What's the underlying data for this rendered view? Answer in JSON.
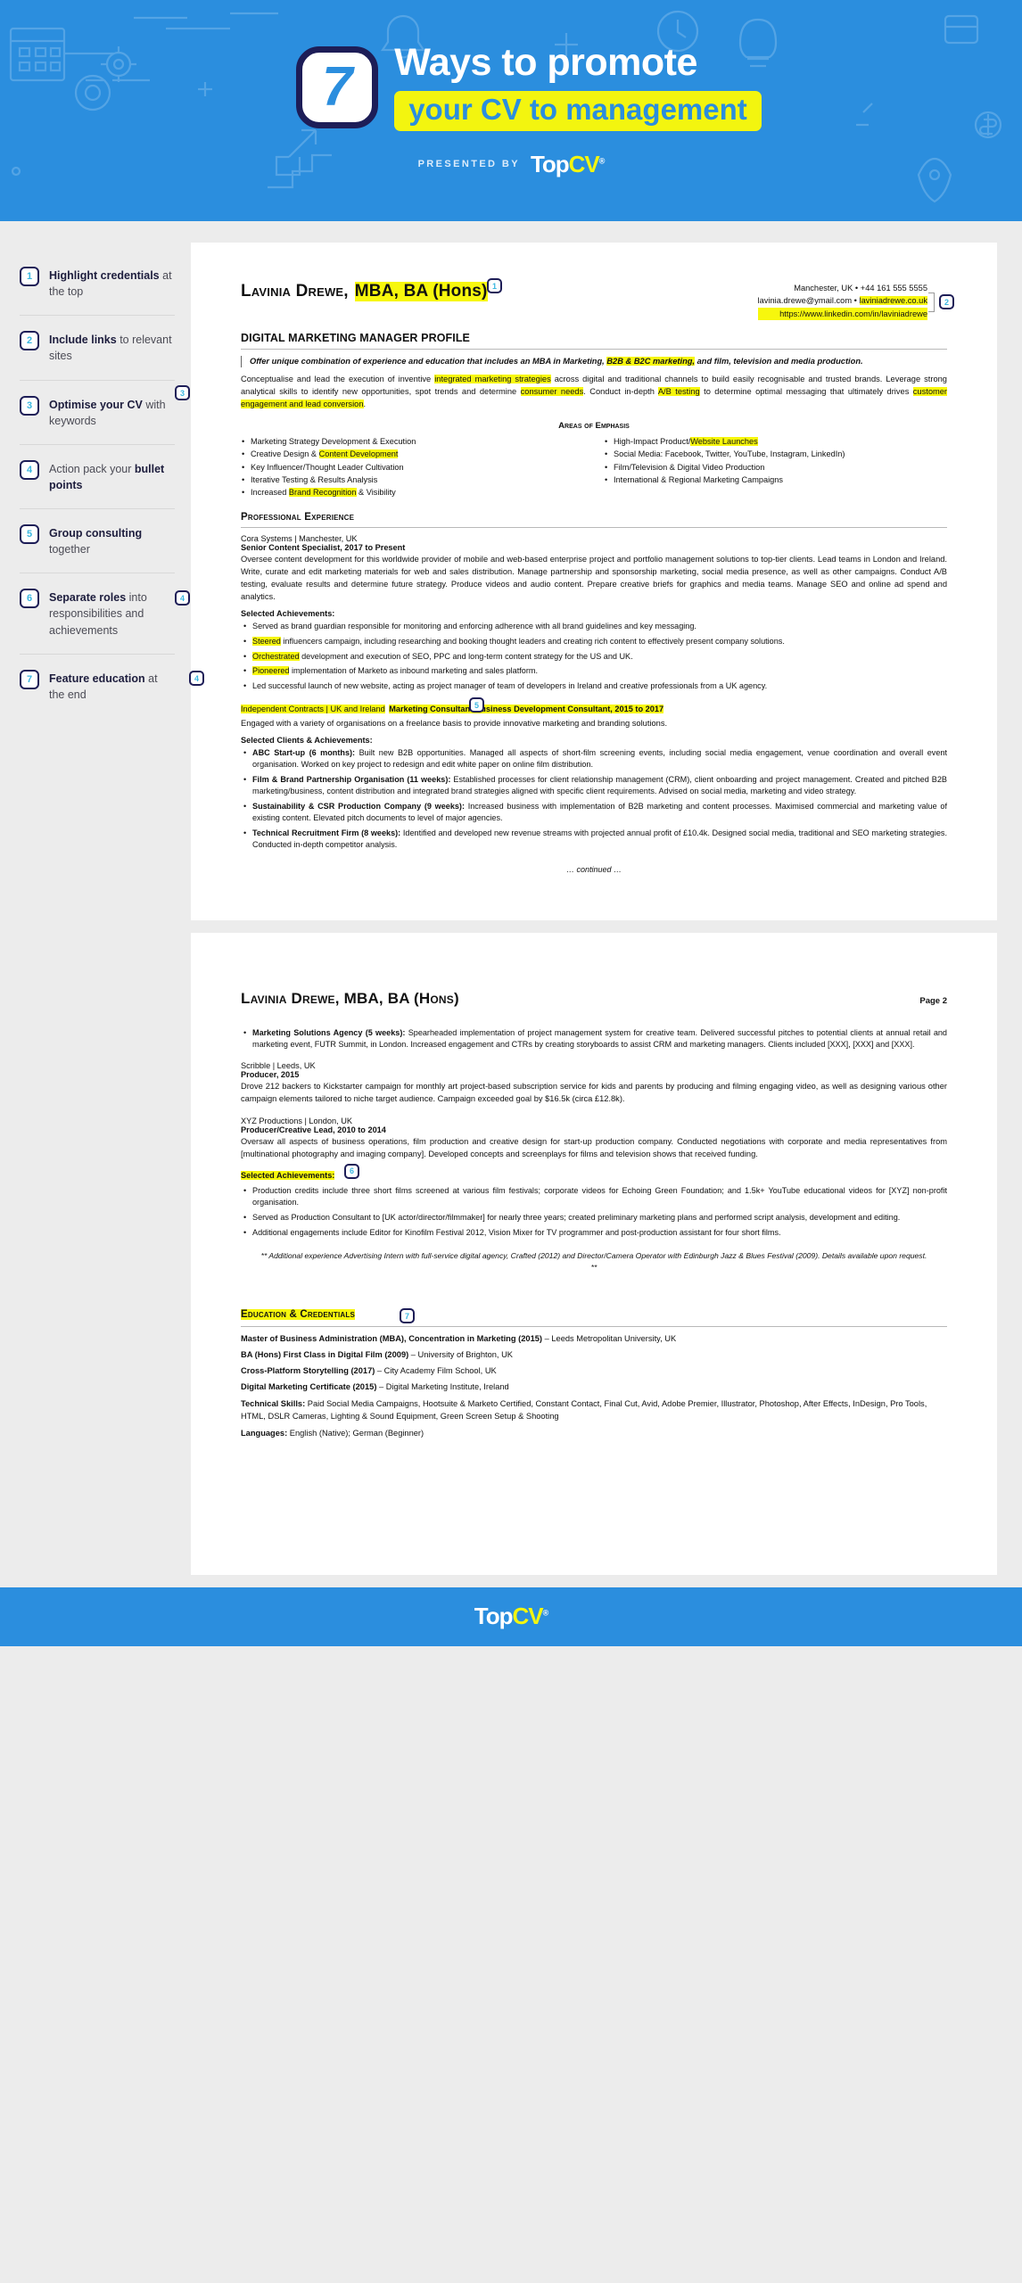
{
  "hero": {
    "number": "7",
    "title": "Ways to promote",
    "title_highlight": "your CV to management",
    "presented_by": "PRESENTED BY",
    "brand_top": "Top",
    "brand_cv": "CV",
    "brand_tm": "®"
  },
  "sidebar": {
    "items": [
      {
        "num": "1",
        "bold": "Highlight credentials",
        "rest": " at the top"
      },
      {
        "num": "2",
        "bold": "Include links",
        "rest": " to relevant sites"
      },
      {
        "num": "3",
        "bold": "Optimise your CV",
        "rest": " with keywords"
      },
      {
        "num": "4",
        "pre": "Action pack your ",
        "bold": "bullet points",
        "rest": ""
      },
      {
        "num": "5",
        "bold": "Group consulting",
        "rest": " together"
      },
      {
        "num": "6",
        "bold": "Separate roles",
        "rest": " into responsibilities and achievements"
      },
      {
        "num": "7",
        "bold": "Feature education",
        "rest": " at the end"
      }
    ]
  },
  "cv": {
    "name_main": "Lavinia Drewe, ",
    "name_highlight": "MBA, BA (Hons)",
    "contact_line1": "Manchester, UK • +44 161 555 5555",
    "contact_email": "lavinia.drewe@ymail.com • ",
    "contact_site": "laviniadrewe.co.uk",
    "contact_linkedin": "https://www.linkedin.com/in/laviniadrewe",
    "job_title": "DIGITAL MARKETING MANAGER PROFILE",
    "summary_a": "Offer unique combination of experience and education that includes an MBA in Marketing, ",
    "summary_b": "B2B & B2C marketing,",
    "summary_c": " and film, television and media production.",
    "para1_a": "Conceptualise and lead the execution of inventive ",
    "para1_hl1": "integrated marketing strategies",
    "para1_b": " across digital and traditional channels to build easily recognisable and trusted brands. Leverage strong analytical skills to identify new opportunities, spot trends and determine ",
    "para1_hl2": "consumer needs",
    "para1_c": ". Conduct in-depth ",
    "para1_hl3": "A/B testing",
    "para1_d": " to determine optimal messaging that ultimately drives ",
    "para1_hl4": "customer engagement and lead conversion",
    "para1_e": ".",
    "emphasis_heading": "Areas of Emphasis",
    "emphasis_left": [
      {
        "text": "Marketing Strategy Development & Execution"
      },
      {
        "pre": "Creative Design & ",
        "hl": "Content Development"
      },
      {
        "text": "Key Influencer/Thought Leader Cultivation"
      },
      {
        "text": "Iterative Testing & Results Analysis"
      },
      {
        "pre": "Increased ",
        "hl": "Brand Recognition",
        "post": " & Visibility"
      }
    ],
    "emphasis_right": [
      {
        "pre": "High-Impact Product/",
        "hl": "Website Launches"
      },
      {
        "text": "Social Media: Facebook, Twitter, YouTube, Instagram, LinkedIn)"
      },
      {
        "text": "Film/Television & Digital Video Production"
      },
      {
        "text": "International & Regional Marketing Campaigns"
      }
    ],
    "experience_heading": "Professional Experience",
    "job1_company": "Cora Systems  |  Manchester, UK",
    "job1_title": "Senior Content Specialist, 2017 to Present",
    "job1_desc": "Oversee content development for this worldwide provider of mobile and web-based enterprise project and portfolio management solutions to top-tier clients. Lead teams in London and Ireland. Write, curate and edit marketing materials for web and sales distribution. Manage partnership and sponsorship marketing, social media presence, as well as other campaigns. Conduct A/B testing, evaluate results and determine future strategy. Produce videos and audio content. Prepare creative briefs for graphics and media teams. Manage SEO and online ad spend and analytics.",
    "selected_ach_label": "Selected Achievements:",
    "job1_bullets": [
      {
        "text": "Served as brand guardian responsible for monitoring and enforcing adherence with all brand guidelines and key messaging."
      },
      {
        "hl": "Steered",
        "post": " influencers campaign, including researching and booking thought leaders and creating rich content to effectively present company solutions."
      },
      {
        "hl": "Orchestrated",
        "post": " development and execution of SEO, PPC and long-term content strategy for the US and UK."
      },
      {
        "hl": "Pioneered",
        "post": " implementation of Marketo as inbound marketing and sales platform."
      },
      {
        "text": "Led successful launch of new website, acting as project manager of team of developers in Ireland and creative professionals from a UK agency."
      }
    ],
    "job2_company": "Independent Contracts  |  UK and Ireland",
    "job2_title": "Marketing Consultant/Business Development Consultant, 2015 to 2017",
    "job2_desc": "Engaged with a variety of organisations on a freelance basis to provide innovative marketing and branding solutions.",
    "selected_clients_label": "Selected Clients & Achievements:",
    "job2_bullets": [
      {
        "bold": "ABC Start-up (6 months):",
        "post": " Built new B2B opportunities. Managed all aspects of short-film screening events, including social media engagement, venue coordination and overall event organisation. Worked on key project to redesign and edit white paper on online film distribution."
      },
      {
        "bold": "Film & Brand Partnership Organisation (11 weeks):",
        "post": " Established processes for client relationship management (CRM), client onboarding and project management. Created and pitched B2B marketing/business, content distribution and integrated brand strategies aligned with specific client requirements. Advised on social media, marketing and video strategy."
      },
      {
        "bold": "Sustainability & CSR Production Company (9 weeks):",
        "post": " Increased business with implementation of B2B marketing and content processes. Maximised commercial and marketing value of existing content. Elevated pitch documents to level of major agencies."
      },
      {
        "bold": "Technical Recruitment Firm (8 weeks):",
        "post": " Identified and developed new revenue streams with projected annual profit of £10.4k. Designed social media, traditional and SEO marketing strategies. Conducted in-depth competitor analysis."
      }
    ],
    "continued": "… continued …"
  },
  "cv_page2": {
    "name_main": "Lavinia Drewe, MBA, BA (Hons)",
    "page_label": "Page 2",
    "top_bullet": {
      "bold": "Marketing Solutions Agency (5 weeks):",
      "post": " Spearheaded implementation of project management system for creative team. Delivered successful pitches to potential clients at annual retail and marketing event, FUTR Summit, in London. Increased engagement and CTRs by creating storyboards to assist CRM and marketing managers. Clients included [XXX], [XXX] and [XXX]."
    },
    "job3_company": "Scribble  |  Leeds, UK",
    "job3_title": "Producer, 2015",
    "job3_desc": "Drove 212 backers to Kickstarter campaign for monthly art project-based subscription service for kids and parents by producing and filming engaging video, as well as designing various other campaign elements tailored to niche target audience. Campaign exceeded goal by $16.5k (circa £12.8k).",
    "job4_company": "XYZ Productions  |  London, UK",
    "job4_title": "Producer/Creative Lead, 2010 to 2014",
    "job4_desc": "Oversaw all aspects of business operations, film production and creative design for start-up production company. Conducted negotiations with corporate and media representatives from [multinational photography and imaging company]. Developed concepts and screenplays for films and television shows that received funding.",
    "selected_ach_label": "Selected Achievements:",
    "job4_bullets": [
      {
        "text": "Production credits include three short films screened at various film festivals; corporate videos for Echoing Green Foundation; and 1.5k+ YouTube educational videos for [XYZ] non-profit organisation."
      },
      {
        "text": "Served as Production Consultant to [UK actor/director/filmmaker] for nearly three years; created preliminary marketing plans and performed script analysis, development and editing."
      },
      {
        "text": "Additional engagements include Editor for Kinofilm Festival 2012, Vision Mixer for TV programmer and post-production assistant for four short films."
      }
    ],
    "note": "** Additional experience Advertising Intern with full-service digital agency, Crafted (2012) and Director/Camera Operator with Edinburgh Jazz & Blues Festival (2009). Details available upon request. **",
    "education_heading": "Education & Credentials",
    "education": [
      {
        "bold": "Master of Business Administration (MBA), Concentration in Marketing (2015)",
        "post": " – Leeds Metropolitan University, UK"
      },
      {
        "bold": "BA (Hons) First Class in Digital Film (2009)",
        "post": " – University of Brighton, UK"
      },
      {
        "bold": "Cross-Platform Storytelling (2017)",
        "post": " – City Academy Film School, UK"
      },
      {
        "bold": "Digital Marketing Certificate (2015)",
        "post": " – Digital Marketing Institute, Ireland"
      },
      {
        "bold": "Technical Skills:",
        "post": " Paid Social Media Campaigns, Hootsuite & Marketo Certified, Constant Contact, Final Cut, Avid, Adobe Premier, Illustrator, Photoshop, After Effects, InDesign, Pro Tools, HTML, DSLR Cameras, Lighting & Sound Equipment, Green Screen Setup & Shooting"
      },
      {
        "bold": "Languages:",
        "post": " English (Native); German (Beginner)"
      }
    ]
  },
  "markers": {
    "m1": "1",
    "m2": "2",
    "m3": "3",
    "m4": "4",
    "m5": "5",
    "m6": "6",
    "m7": "7"
  },
  "footer": {
    "brand_top": "Top",
    "brand_cv": "CV",
    "brand_tm": "®"
  },
  "colors": {
    "brand_blue": "#2b8ede",
    "navy": "#1d1d57",
    "cyan": "#3bb7e0",
    "yellow": "#f3f50f",
    "hl_yellow": "#f7f70d"
  }
}
